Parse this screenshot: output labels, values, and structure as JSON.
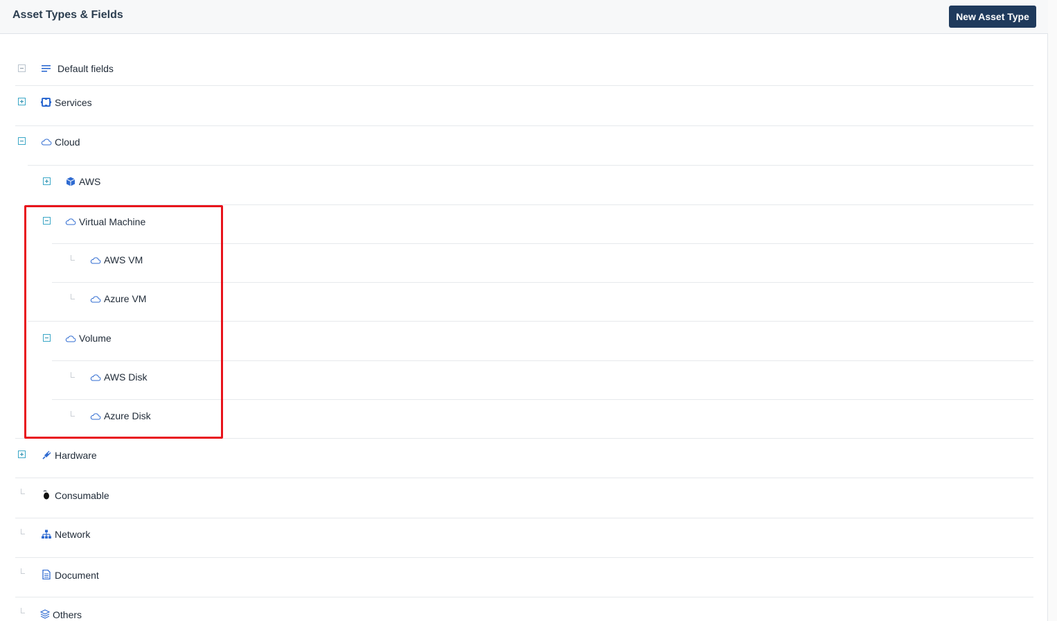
{
  "header": {
    "title": "Asset Types & Fields",
    "new_button": "New Asset Type"
  },
  "tree": {
    "default_fields": "Default fields",
    "services": "Services",
    "cloud": "Cloud",
    "aws": "AWS",
    "virtual_machine": "Virtual Machine",
    "aws_vm": "AWS VM",
    "azure_vm": "Azure VM",
    "volume": "Volume",
    "aws_disk": "AWS Disk",
    "azure_disk": "Azure Disk",
    "hardware": "Hardware",
    "consumable": "Consumable",
    "network": "Network",
    "document": "Document",
    "others": "Others"
  },
  "icons": {
    "default_fields": "list-lines-icon",
    "services": "gear-puzzle-icon",
    "cloud": "cloud-icon",
    "aws": "cube-icon",
    "hardware": "plug-icon",
    "consumable": "mouse-icon",
    "network": "network-icon",
    "document": "document-icon",
    "others": "layers-icon"
  },
  "colors": {
    "accent": "#1f3a5c",
    "icon_blue": "#2f6bd1",
    "highlight": "#e8121b"
  }
}
